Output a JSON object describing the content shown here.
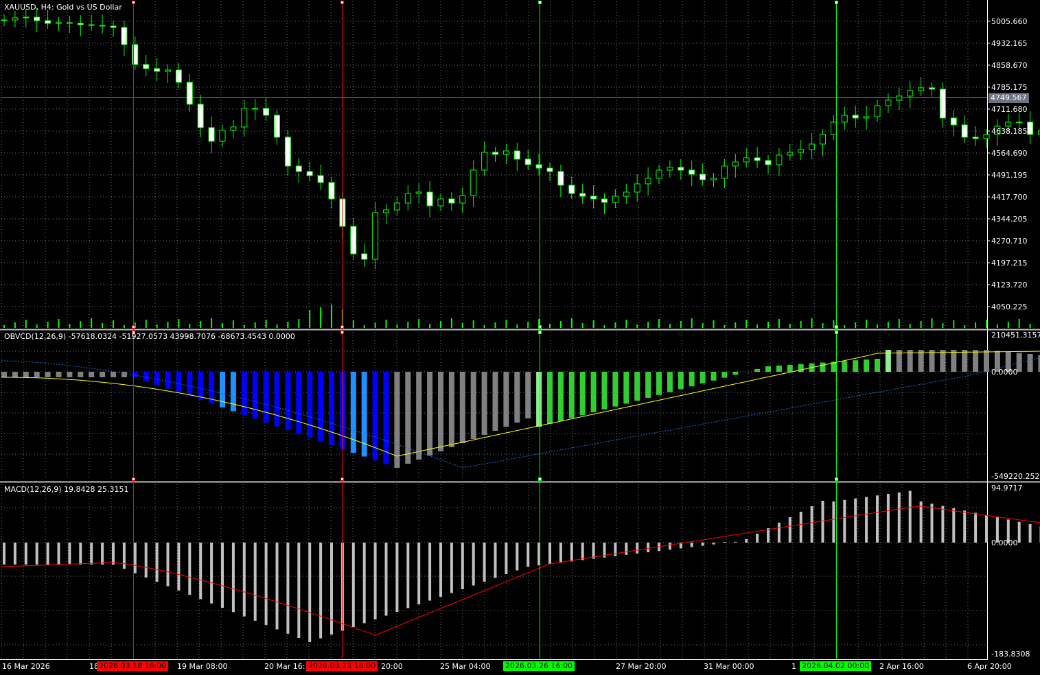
{
  "symbol_title": "XAUUSD, H4:  Gold vs US Dollar",
  "current_price": "4749.567",
  "price_axis": [
    "5005.660",
    "4932.165",
    "4858.670",
    "4785.175",
    "4711.680",
    "4638.185",
    "4564.690",
    "4491.195",
    "4417.700",
    "4344.205",
    "4270.710",
    "4197.215",
    "4123.720",
    "4050.225"
  ],
  "obvcd": {
    "title": "OBVCD(12,26,9) -57618.0324 -51927.0573 43998.7076 -68673.4543 0.0000",
    "axis_top": "210451.3157",
    "axis_zero": "0.0000",
    "axis_bottom": "-549220.252"
  },
  "macd": {
    "title": "MACD(12,26,9) 19.8428 25.3151",
    "axis_top": "94.9717",
    "axis_zero": "0.0000",
    "axis_bottom": "-183.8308"
  },
  "time_axis": [
    "16 Mar 2026",
    "18",
    "19 Mar 08:00",
    "20 Mar 16:",
    "20:00",
    "25 Mar 04:00",
    "27 Mar 20:00",
    "31 Mar 00:00",
    "1",
    "2 Apr 16:00",
    "6 Apr 20:00"
  ],
  "vlines": [
    {
      "label": "2026.03.18 16:00",
      "color": "#ff0000"
    },
    {
      "label": "2026.03.23 16:00",
      "color": "#ff0000"
    },
    {
      "label": "2026.03.26 16:00",
      "color": "#00ff00"
    },
    {
      "label": "2026.04.02 00:00",
      "color": "#00ff00"
    }
  ],
  "colors": {
    "background": "#000000",
    "grid": "#6b7480",
    "axis": "#ffffff",
    "bull": "#00ff00",
    "bear_body": "#ffffff",
    "obv_grey": "#808080",
    "obv_blue": "#0000ff",
    "obv_lightblue": "#1e90ff",
    "obv_green": "#32cd32",
    "obv_lightgreen": "#90ee90",
    "signal_yellow": "#ffff00",
    "signal_blue": "#1e6fd8",
    "macd_hist": "#c0c0c0",
    "macd_signal": "#ff0000"
  }
}
